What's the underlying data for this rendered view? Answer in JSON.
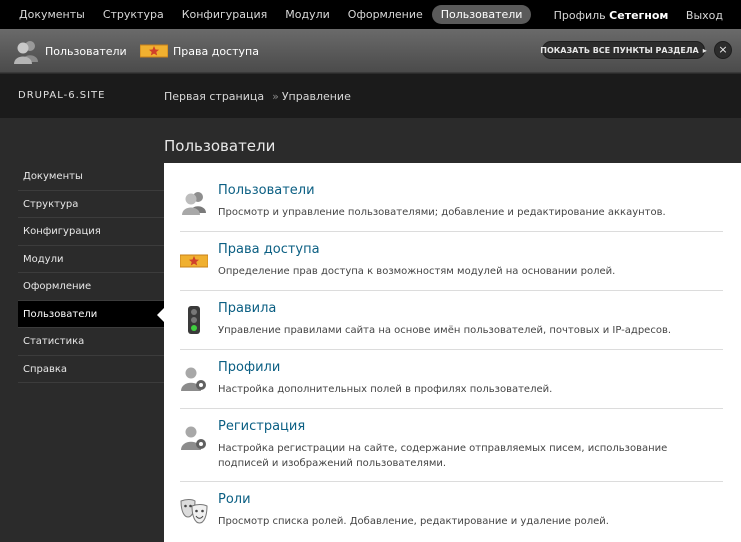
{
  "toolbar": {
    "nav": [
      "Документы",
      "Структура",
      "Конфигурация",
      "Модули",
      "Оформление",
      "Пользователи"
    ],
    "active_index": 5,
    "profile_label": "Профиль",
    "username": "Сетегном",
    "logout_label": "Выход"
  },
  "shortcuts": {
    "items": [
      {
        "label": "Пользователи",
        "icon": "users-icon"
      },
      {
        "label": "Права доступа",
        "icon": "key-card-icon"
      }
    ],
    "show_all_label": "ПОКАЗАТЬ ВСЕ ПУНКТЫ РАЗДЕЛА",
    "close_symbol": "×"
  },
  "header": {
    "site_name": "DRUPAL-6.SITE",
    "breadcrumb": [
      "Первая страница",
      "Управление"
    ]
  },
  "page_title": "Пользователи",
  "sidebar": {
    "items": [
      "Документы",
      "Структура",
      "Конфигурация",
      "Модули",
      "Оформление",
      "Пользователи",
      "Статистика",
      "Справка"
    ],
    "active_index": 5
  },
  "entries": [
    {
      "title": "Пользователи",
      "desc": "Просмотр и управление пользователями; добавление и редактирование аккаунтов.",
      "icon": "users-icon"
    },
    {
      "title": "Права доступа",
      "desc": "Определение прав доступа к возможностям модулей на основании ролей.",
      "icon": "key-card-icon"
    },
    {
      "title": "Правила",
      "desc": "Управление правилами сайта на основе имён пользователей, почтовых и IP-адресов.",
      "icon": "traffic-light-icon"
    },
    {
      "title": "Профили",
      "desc": "Настройка дополнительных полей в профилях пользователей.",
      "icon": "user-settings-icon"
    },
    {
      "title": "Регистрация",
      "desc": "Настройка регистрации на сайте, содержание отправляемых писем, использование подписей и изображений пользователями.",
      "icon": "user-settings-icon"
    },
    {
      "title": "Роли",
      "desc": "Просмотр списка ролей. Добавление, редактирование и удаление ролей.",
      "icon": "theater-masks-icon"
    }
  ],
  "colors": {
    "link": "#0b5f83",
    "toolbar_bg": "#000000",
    "header_bg": "#1b1b1b",
    "body_bg": "#2b2b2b"
  }
}
